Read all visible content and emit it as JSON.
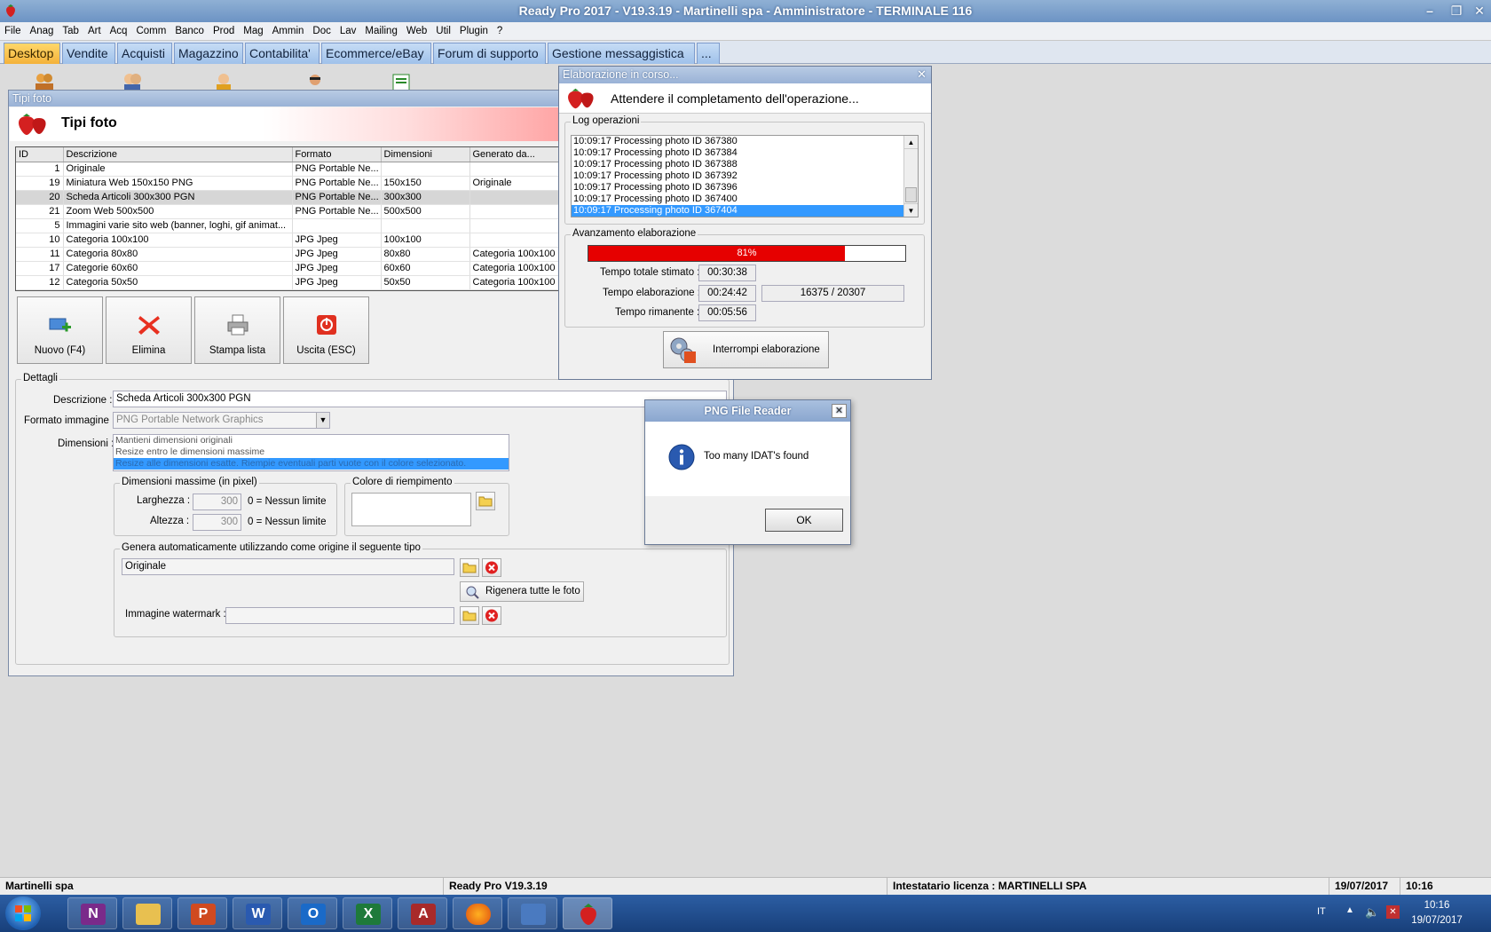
{
  "app": {
    "title": "Ready Pro 2017 - V19.3.19 - Martinelli spa - Amministratore - TERMINALE 116"
  },
  "menu": [
    "File",
    "Anag",
    "Tab",
    "Art",
    "Acq",
    "Comm",
    "Banco",
    "Prod",
    "Mag",
    "Ammin",
    "Doc",
    "Lav",
    "Mailing",
    "Web",
    "Util",
    "Plugin",
    "?"
  ],
  "tabs": [
    "Desktop",
    "Vendite",
    "Acquisti",
    "Magazzino",
    "Contabilita'",
    "Ecommerce/eBay",
    "Forum di supporto",
    "Gestione messaggistica",
    "..."
  ],
  "tipi_foto": {
    "window_title": "Tipi foto",
    "header": "Tipi foto",
    "columns": [
      "ID",
      "Descrizione",
      "Formato",
      "Dimensioni",
      "Generato da..."
    ],
    "rows": [
      [
        "1",
        "Originale",
        "PNG Portable Ne...",
        "",
        ""
      ],
      [
        "19",
        "Miniatura Web 150x150 PNG",
        "PNG Portable Ne...",
        "150x150",
        "Originale"
      ],
      [
        "20",
        "Scheda Articoli 300x300 PGN",
        "PNG Portable Ne...",
        "300x300",
        ""
      ],
      [
        "21",
        "Zoom Web 500x500",
        "PNG Portable Ne...",
        "500x500",
        ""
      ],
      [
        "5",
        "Immagini varie sito web (banner, loghi, gif animat...",
        "",
        "",
        ""
      ],
      [
        "10",
        "Categoria 100x100",
        "JPG Jpeg",
        "100x100",
        ""
      ],
      [
        "11",
        "Categoria 80x80",
        "JPG Jpeg",
        "80x80",
        "Categoria 100x100"
      ],
      [
        "17",
        "Categorie 60x60",
        "JPG Jpeg",
        "60x60",
        "Categoria 100x100"
      ],
      [
        "12",
        "Categoria 50x50",
        "JPG Jpeg",
        "50x50",
        "Categoria 100x100"
      ]
    ],
    "buttons": {
      "new": "Nuovo (F4)",
      "delete": "Elimina",
      "print": "Stampa lista",
      "exit": "Uscita (ESC)"
    },
    "details": {
      "group_label": "Dettagli",
      "descrizione_label": "Descrizione :",
      "descrizione_value": "Scheda Articoli 300x300 PGN",
      "formato_label": "Formato immagine :",
      "formato_value": "PNG Portable Network Graphics",
      "dimensioni_label": "Dimensioni :",
      "dimensioni_options": [
        "Mantieni dimensioni originali",
        "Resize entro le dimensioni massime",
        "Resize alle dimensioni esatte. Riempie eventuali parti vuote con il colore selezionato."
      ],
      "dim_max_label": "Dimensioni massime (in pixel)",
      "larghezza_label": "Larghezza :",
      "larghezza_value": "300",
      "altezza_label": "Altezza :",
      "altezza_value": "300",
      "nessun_limite": "0 = Nessun limite",
      "colore_label": "Colore di riempimento",
      "genera_label": "Genera automaticamente utilizzando come origine il seguente tipo",
      "origine_value": "Originale",
      "rigenera_button": "Rigenera tutte le foto",
      "watermark_label": "Immagine watermark :"
    }
  },
  "progress_dialog": {
    "title": "Elaborazione in corso...",
    "header": "Attendere il completamento dell'operazione...",
    "log_label": "Log operazioni",
    "log": [
      "10:09:17 Processing photo ID 367380",
      "10:09:17 Processing photo ID 367384",
      "10:09:17 Processing photo ID 367388",
      "10:09:17 Processing photo ID 367392",
      "10:09:17 Processing photo ID 367396",
      "10:09:17 Processing photo ID 367400",
      "10:09:17 Processing photo ID 367404"
    ],
    "avanzamento_label": "Avanzamento elaborazione",
    "progress_text": "81%",
    "progress_fraction": 0.81,
    "totale_label": "Tempo totale stimato :",
    "totale_value": "00:30:38",
    "elaborazione_label": "Tempo elaborazione :",
    "elaborazione_value": "00:24:42",
    "count_value": "16375 / 20307",
    "rimanente_label": "Tempo rimanente :",
    "rimanente_value": "00:05:56",
    "stop_button": "Interrompi elaborazione"
  },
  "png_dialog": {
    "title": "PNG File Reader",
    "message": "Too many IDAT's found",
    "ok": "OK"
  },
  "status": {
    "company": "Martinelli spa",
    "version": "Ready Pro V19.3.19",
    "license": "Intestatario licenza : MARTINELLI SPA",
    "date": "19/07/2017",
    "time": "10:16"
  },
  "taskbar": {
    "lang": "IT",
    "time": "10:16",
    "date": "19/07/2017"
  },
  "colors": {
    "progress": "#e60000",
    "selection": "#3399ff",
    "tab_active": "#f4b23a"
  }
}
